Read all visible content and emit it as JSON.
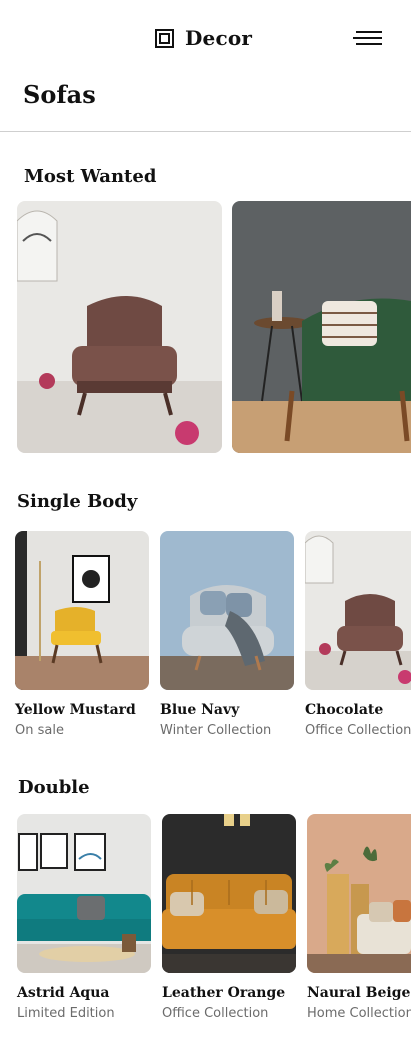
{
  "header": {
    "brand": "Decor",
    "logo_icon": "square-logo-icon",
    "menu_icon": "hamburger-menu-icon"
  },
  "page": {
    "title": "Sofas"
  },
  "sections": [
    {
      "title": "Most Wanted"
    },
    {
      "title": "Single Body",
      "items": [
        {
          "name": "Yellow Mustard",
          "subtitle": "On sale"
        },
        {
          "name": "Blue Navy",
          "subtitle": "Winter Collection"
        },
        {
          "name": "Chocolate",
          "subtitle": "Office Collection"
        }
      ]
    },
    {
      "title": "Double",
      "items": [
        {
          "name": "Astrid Aqua",
          "subtitle": "Limited Edition"
        },
        {
          "name": "Leather Orange",
          "subtitle": "Office Collection"
        },
        {
          "name": "Naural Beige",
          "subtitle": "Home Collection"
        }
      ]
    }
  ]
}
